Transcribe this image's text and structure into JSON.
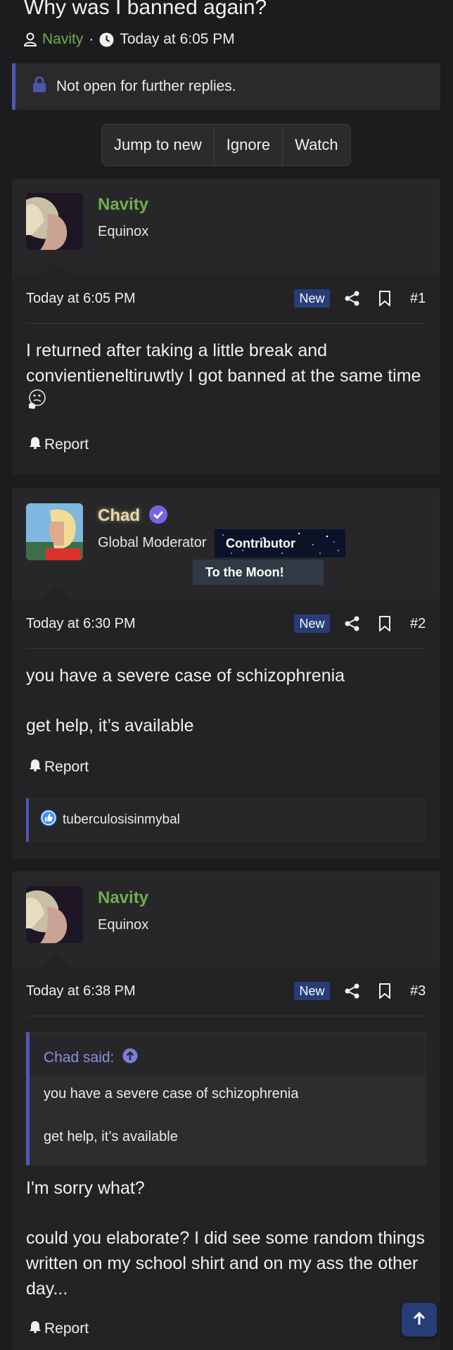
{
  "thread": {
    "title": "Why was I banned again?",
    "author": "Navity",
    "separator": "·",
    "date": "Today at 6:05 PM"
  },
  "notice": {
    "text": "Not open for further replies."
  },
  "actions": {
    "jump_to_new": "Jump to new",
    "ignore": "Ignore",
    "watch": "Watch"
  },
  "posts": [
    {
      "username": "Navity",
      "user_title": "Equinox",
      "date": "Today at 6:05 PM",
      "badge": "New",
      "number": "#1",
      "body": "I returned after taking a little break and convientieneltiruwtly I got banned at the same time",
      "report": "Report"
    },
    {
      "username": "Chad",
      "user_title": "Global Moderator",
      "banner": "Contributor",
      "tooltip": "To the Moon!",
      "date": "Today at 6:30 PM",
      "badge": "New",
      "number": "#2",
      "body_line1": "you have a severe case of schizophrenia",
      "body_line2": "get help, it’s available",
      "report": "Report",
      "reaction_user": "tuberculosisinmybal"
    },
    {
      "username": "Navity",
      "user_title": "Equinox",
      "date": "Today at 6:38 PM",
      "badge": "New",
      "number": "#3",
      "quote_author": "Chad said:",
      "quote_line1": "you have a severe case of schizophrenia",
      "quote_line2": "get help, it’s available",
      "body_line1": "I'm sorry what?",
      "body_line2": "could you elaborate? I did see some random things written on my school shirt and on my ass the other day...",
      "report": "Report"
    }
  ],
  "colors": {
    "accent": "#5158b8",
    "author_green": "#6fae4e",
    "badge_blue": "#263d78",
    "quote_link": "#8a90e0"
  },
  "icons": [
    "user-icon",
    "clock-icon",
    "lock-icon",
    "share-icon",
    "bookmark-icon",
    "bell-icon",
    "verified-badge-icon",
    "like-icon",
    "arrow-up-circle-icon",
    "arrow-up-icon"
  ]
}
